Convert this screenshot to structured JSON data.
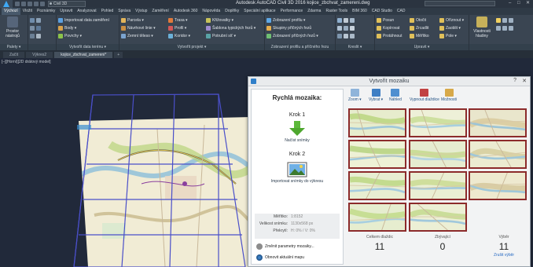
{
  "window": {
    "title": "Autodesk AutoCAD Civil 3D 2016   kojice_zbchvat_zamereni.dwg",
    "workspace": "Civil 3D",
    "controls": [
      "–",
      "□",
      "✕"
    ]
  },
  "ribbon_tabs": [
    {
      "label": "Výchozí",
      "active": true
    },
    {
      "label": "Vložit"
    },
    {
      "label": "Poznámky"
    },
    {
      "label": "Upravit"
    },
    {
      "label": "Analyzovat"
    },
    {
      "label": "Pohled"
    },
    {
      "label": "Správa"
    },
    {
      "label": "Výstup"
    },
    {
      "label": "Zaměření"
    },
    {
      "label": "Autodesk 360"
    },
    {
      "label": "Nápověda"
    },
    {
      "label": "Doplňky"
    },
    {
      "label": "Speciální aplikace"
    },
    {
      "label": "Performance"
    },
    {
      "label": "Zdarma"
    },
    {
      "label": "Raster Tools"
    },
    {
      "label": "BIM 360"
    },
    {
      "label": "CAD Studio"
    },
    {
      "label": "CAD"
    }
  ],
  "ribbon": {
    "tools_label": "Prostor nástrojů",
    "palettes_title": "Palety ▾",
    "data_title": "Vytvořit data terénu ▾",
    "design_title": "Vytvořit projekt ▾",
    "profile_title": "Zobrazení profilu a příčného řezu",
    "draw_title": "Kreslit ▾",
    "modify_title": "Upravit ▾",
    "data_items": [
      "Importovat data zaměření",
      "Body ▾",
      "Povrchy ▾"
    ],
    "design_items": [
      "Parcela ▾",
      "Návrhové linie ▾",
      "Zemní těleso ▾",
      "Trasa ▾",
      "Profil ▾",
      "Koridor ▾",
      "Křižovatky ▾",
      "Šablona typických řezů ▾",
      "Potrubní síť ▾"
    ],
    "profile_items": [
      "Zobrazení profilu ▾",
      "Skupiny příčných řezů",
      "Zobrazení příčných řezů ▾"
    ],
    "modify_items": [
      "Posun",
      "Kopírovat",
      "Protáhnout",
      "Otočit",
      "Zrcadlit",
      "Měřítko",
      "Oříznout ▾",
      "Zaoblit ▾",
      "Pole ▾"
    ],
    "layers_label": "Vlastnosti hladiny"
  },
  "doc_tabs": [
    {
      "label": "Začít"
    },
    {
      "label": "Výkres2"
    },
    {
      "label": "kojice_zbchvat_zamereni*",
      "active": true
    },
    {
      "label": "+",
      "plus": true
    }
  ],
  "viewport": {
    "label": "[–][Horní][2D drátový model]"
  },
  "dialog": {
    "title": "Vytvořit mozaiku",
    "help": "?",
    "close": "✕",
    "heading": "Rychlá mozaika:",
    "step1_title": "Krok 1",
    "step1_button": "Načíst snímky",
    "step2_title": "Krok 2",
    "step2_button": "Importovat snímky do výkresu",
    "info": [
      {
        "key": "Měřítko:",
        "value": "1:8152"
      },
      {
        "key": "Velikost snímku:",
        "value": "1130x568 px"
      },
      {
        "key": "Překrytí:",
        "value": "H: 0% / V: 0%"
      }
    ],
    "change_params": "Změnit parametry mozaiky...",
    "refresh_map": "Obnovit aktuální mapu",
    "toolbar": [
      {
        "label": "Zoom ▾",
        "color": "#8fb4da"
      },
      {
        "label": "Vybrat ▾",
        "color": "#3f7fc4"
      },
      {
        "label": "Náhled",
        "color": "#4f8fd0"
      },
      {
        "label": "Vypnout dlaždice",
        "color": "#c14242"
      },
      {
        "label": "Možnosti",
        "color": "#d7a94a"
      }
    ],
    "stats": {
      "total_label": "Celkem dlaždic",
      "total_value": "11",
      "processed_label": "Zbývající",
      "processed_value": "0",
      "selected_label": "Výběr",
      "selected_value": "11",
      "selected_link": "Zrušit výběr"
    }
  },
  "colors": {
    "accent": "#2f7fc9",
    "tile_border": "#8c2b2b",
    "ribbon_bg": "#3a4552",
    "viewport_bg": "#21293a"
  }
}
